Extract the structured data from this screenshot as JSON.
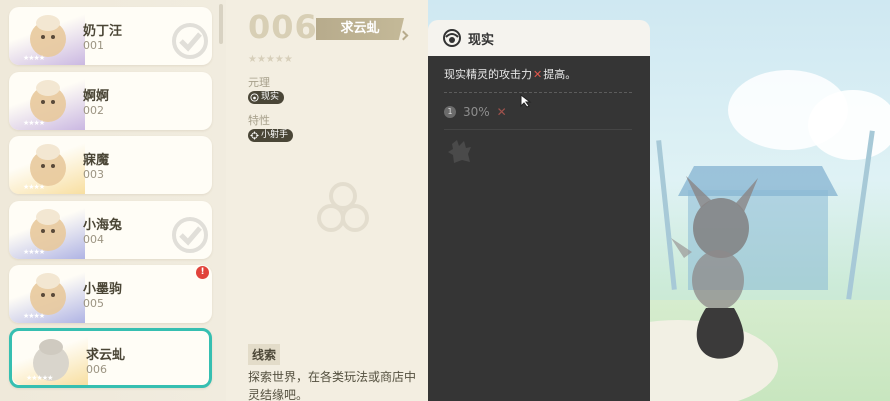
{
  "list": {
    "items": [
      {
        "name": "奶丁汪",
        "number": "001",
        "stars": "★★★★",
        "accent": "#9f7fd1",
        "check": true,
        "alert": false
      },
      {
        "name": "婀婀",
        "number": "002",
        "stars": "★★★★",
        "accent": "#9f7fd1",
        "check": false,
        "alert": false
      },
      {
        "name": "寐魔",
        "number": "003",
        "stars": "★★★★",
        "accent": "#f2c65b",
        "check": false,
        "alert": false
      },
      {
        "name": "小海兔",
        "number": "004",
        "stars": "★★★★",
        "accent": "#6f78d6",
        "check": true,
        "alert": false
      },
      {
        "name": "小墨驹",
        "number": "005",
        "stars": "★★★★",
        "accent": "#6f78d6",
        "check": false,
        "alert": true,
        "alert_mark": "!"
      },
      {
        "name": "求云虬",
        "number": "006",
        "stars": "★★★★★",
        "accent": "#f2c65b",
        "check": false,
        "alert": false,
        "selected": true
      }
    ]
  },
  "detail": {
    "number": "006",
    "name": "求云虬",
    "stars": "★★★★★",
    "element_label": "元理",
    "element_value": "现实",
    "trait_label": "特性",
    "trait_value": "小射手",
    "clue_heading": "线索",
    "clue_text_1": "探索世界，在各类玩法或商店中",
    "clue_text_2": "灵结缘吧。"
  },
  "tooltip": {
    "title": "现实",
    "desc_before": "现实精灵的攻击力",
    "desc_after": "提高。",
    "level": "1",
    "value": "30%",
    "x_mark": "✕"
  },
  "colors": {
    "teal_selection": "#36bfb1",
    "alert_red": "#e1433b",
    "panel_dark": "#353535"
  }
}
